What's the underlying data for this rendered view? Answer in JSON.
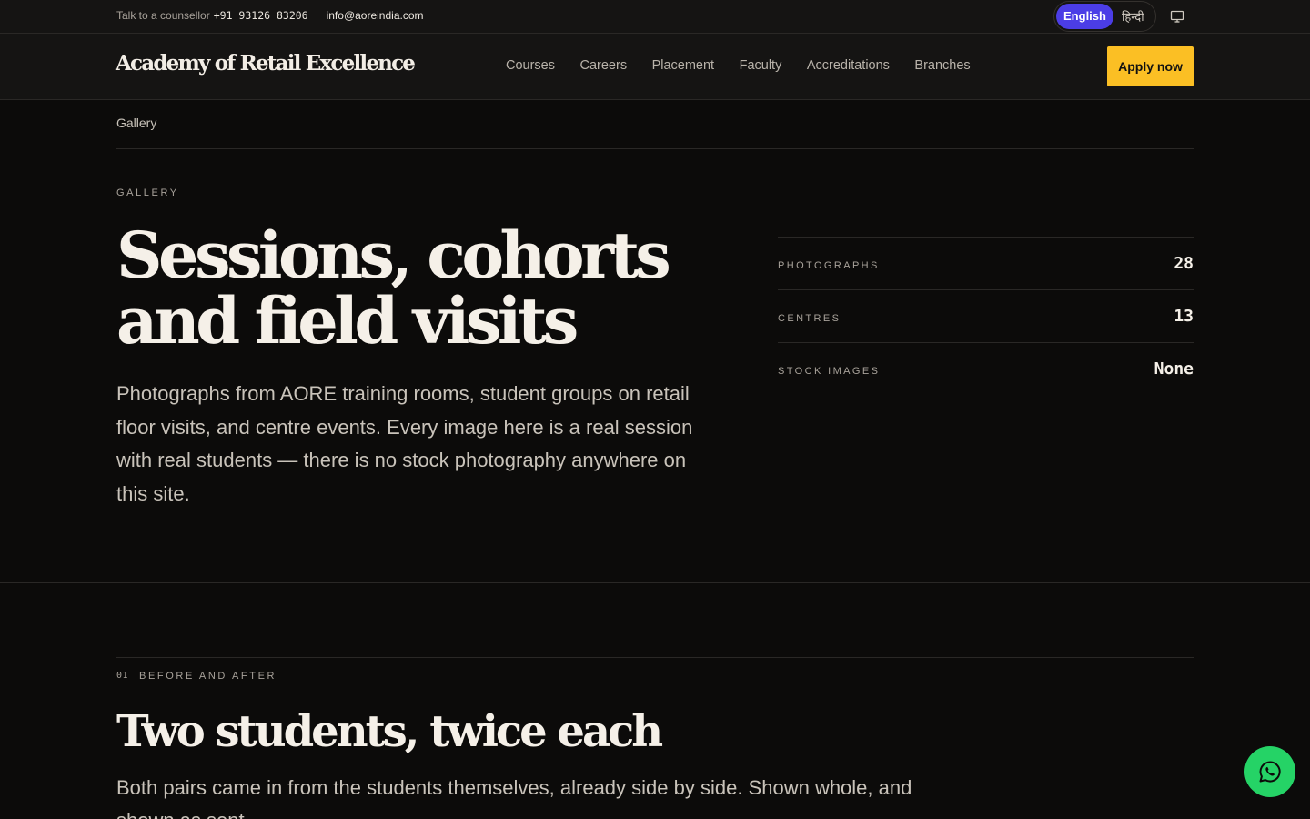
{
  "topbar": {
    "counsellor_label": "Talk to a counsellor",
    "phone": "+91 93126 83206",
    "email": "info@aoreindia.com",
    "languages": [
      "English",
      "हिन्दी"
    ],
    "active_language": "English"
  },
  "nav": {
    "logo": "Academy of Retail Excellence",
    "items": [
      "Courses",
      "Careers",
      "Placement",
      "Faculty",
      "Accreditations",
      "Branches"
    ],
    "cta": "Apply now"
  },
  "breadcrumb": "Gallery",
  "hero": {
    "eyebrow": "GALLERY",
    "title": "Sessions, cohorts and field visits",
    "body": "Photographs from AORE training rooms, student groups on retail floor visits, and centre events. Every image here is a real session with real students — there is no stock photography anywhere on this site."
  },
  "stats": [
    {
      "label": "PHOTOGRAPHS",
      "value": "28"
    },
    {
      "label": "CENTRES",
      "value": "13"
    },
    {
      "label": "STOCK IMAGES",
      "value": "None"
    }
  ],
  "section": {
    "number": "01",
    "eyebrow": "BEFORE AND AFTER",
    "title": "Two students, twice each",
    "body": "Both pairs came in from the students themselves, already side by side. Shown whole, and shown as sent."
  },
  "colors": {
    "background": "#0c0b0a",
    "accent": "#fbbf24",
    "language_active": "#4b3de6",
    "whatsapp": "#25d366"
  },
  "icons": [
    "monitor-icon",
    "whatsapp-icon"
  ]
}
